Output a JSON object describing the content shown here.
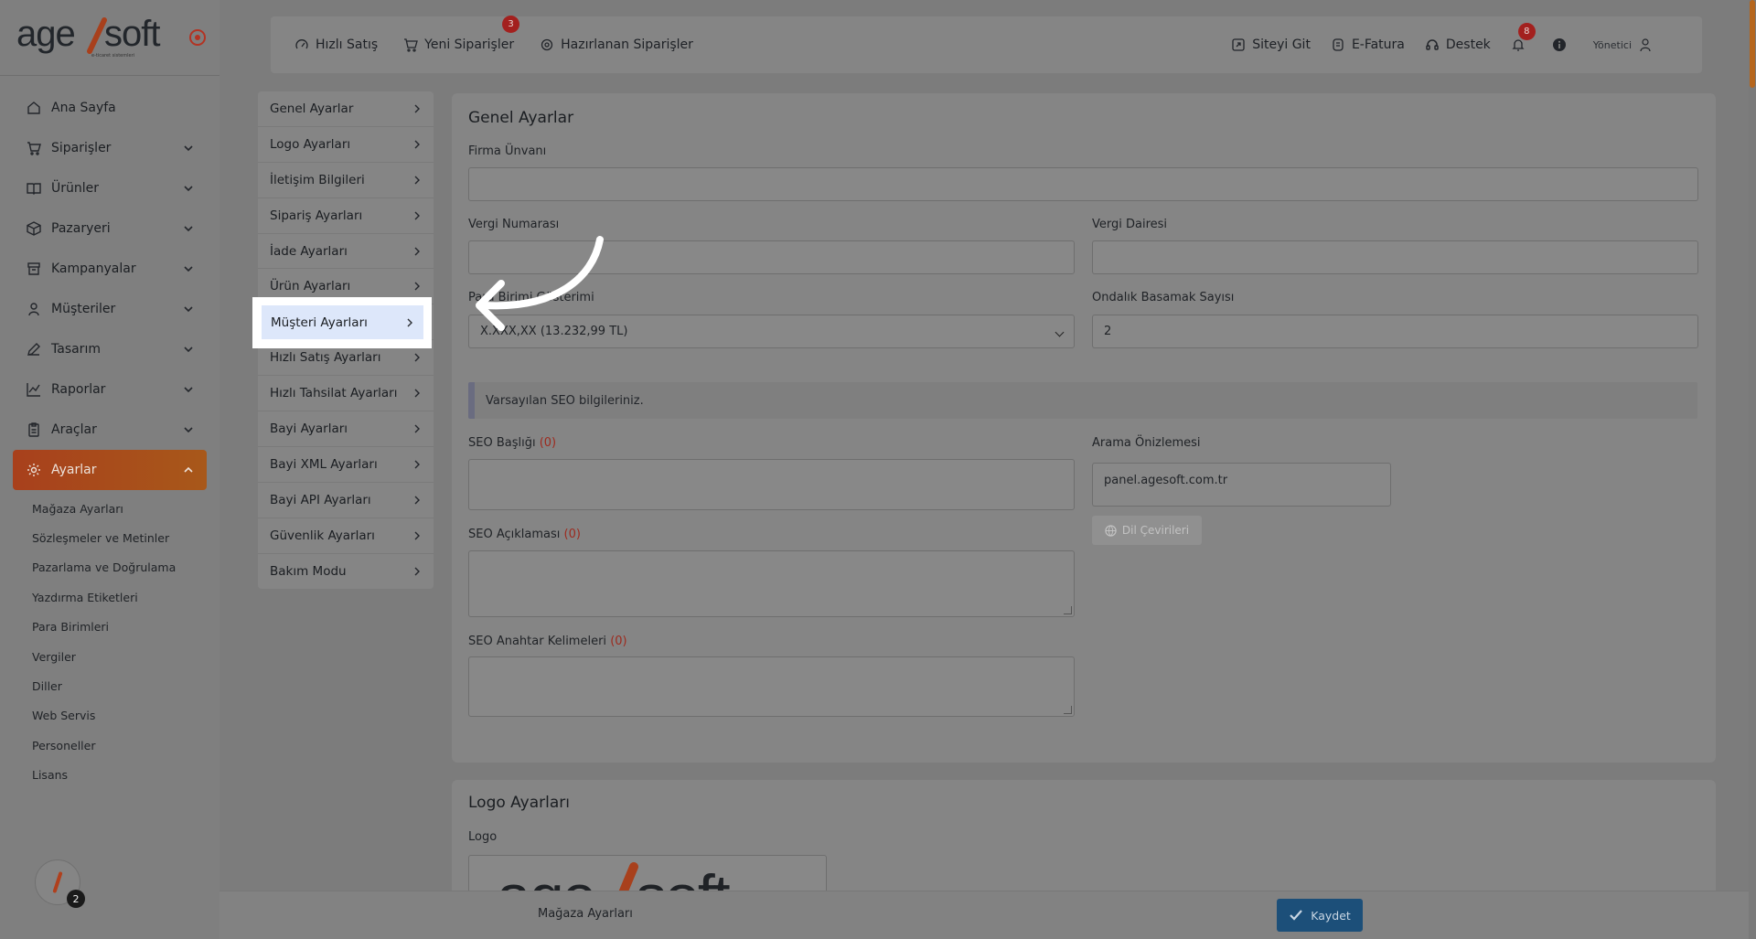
{
  "brand": {
    "logo_text": "age/soft",
    "logo_tagline": "e-ticaret sistemleri"
  },
  "sidebar": {
    "items": [
      {
        "label": "Ana Sayfa",
        "icon": "home-icon",
        "expandable": false
      },
      {
        "label": "Siparişler",
        "icon": "cart-icon",
        "expandable": true
      },
      {
        "label": "Ürünler",
        "icon": "book-icon",
        "expandable": true
      },
      {
        "label": "Pazaryeri",
        "icon": "box-icon",
        "expandable": true
      },
      {
        "label": "Kampanyalar",
        "icon": "basket-icon",
        "expandable": true
      },
      {
        "label": "Müşteriler",
        "icon": "user-icon",
        "expandable": true
      },
      {
        "label": "Tasarım",
        "icon": "pen-icon",
        "expandable": true
      },
      {
        "label": "Raporlar",
        "icon": "chart-icon",
        "expandable": true
      },
      {
        "label": "Araçlar",
        "icon": "clipboard-icon",
        "expandable": true
      },
      {
        "label": "Ayarlar",
        "icon": "gear-icon",
        "expandable": true,
        "active": true
      }
    ],
    "sub_items": [
      "Mağaza Ayarları",
      "Sözleşmeler ve Metinler",
      "Pazarlama ve Doğrulama",
      "Yazdırma Etiketleri",
      "Para Birimleri",
      "Vergiler",
      "Diller",
      "Web Servis",
      "Personeller",
      "Lisans"
    ],
    "bottom_badge": "2"
  },
  "topbar": {
    "quick_sale": "Hızlı Satış",
    "new_orders": "Yeni Siparişler",
    "new_orders_badge": "3",
    "prepared_orders": "Hazırlanan Siparişler",
    "go_site": "Siteyi Git",
    "efatura": "E-Fatura",
    "support": "Destek",
    "notif_badge": "8",
    "user": "Yönetici"
  },
  "settings_menu": {
    "items": [
      "Genel Ayarlar",
      "Logo Ayarları",
      "İletişim Bilgileri",
      "Sipariş Ayarları",
      "İade Ayarları",
      "Ürün Ayarları",
      "Müşteri Ayarları",
      "Hızlı Satış Ayarları",
      "Hızlı Tahsilat Ayarları",
      "Bayi Ayarları",
      "Bayi XML Ayarları",
      "Bayi API Ayarları",
      "Güvenlik Ayarları",
      "Bakım Modu"
    ],
    "highlighted": "Müşteri Ayarları"
  },
  "general": {
    "title": "Genel Ayarlar",
    "company_label": "Firma Ünvanı",
    "company_value": "",
    "tax_no_label": "Vergi Numarası",
    "tax_no_value": "",
    "tax_office_label": "Vergi Dairesi",
    "tax_office_value": "",
    "currency_label": "Para Birimi Gösterimi",
    "currency_value": "X.XXX,XX (13.232,99 TL)",
    "decimal_label": "Ondalık Basamak Sayısı",
    "decimal_value": "2",
    "seo_info": "Varsayılan SEO bilgileriniz.",
    "seo_title_label": "SEO Başlığı",
    "seo_title_count": "(0)",
    "seo_desc_label": "SEO Açıklaması",
    "seo_desc_count": "(0)",
    "seo_keywords_label": "SEO Anahtar Kelimeleri",
    "seo_keywords_count": "(0)",
    "preview_label": "Arama Önizlemesi",
    "preview_url": "panel.agesoft.com.tr",
    "lang_button": "Dil Çevirileri"
  },
  "logo_settings": {
    "title": "Logo Ayarları",
    "logo_label": "Logo",
    "logo_preview_text": "age/soft"
  },
  "bottom": {
    "label": "Mağaza Ayarları",
    "save": "Kaydet"
  },
  "colors": {
    "accent": "#a8481b",
    "save": "#1c4f79",
    "badge": "#a3201e",
    "overlay": "#7f7f7f"
  }
}
